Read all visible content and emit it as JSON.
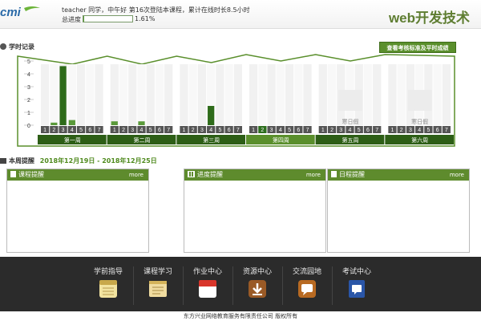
{
  "header": {
    "logo_text": "cmi",
    "greeting": "teacher 同学，中午好  第16次登陆本课程，累计在线时长8.5小时",
    "progress_label": "总进度",
    "progress_value": 0.0161,
    "progress_text": "1.61%",
    "brand": "web开发技术"
  },
  "study": {
    "title": "学时记录",
    "button": "查看考核标准及平时成绩"
  },
  "chart_data": {
    "type": "bar",
    "yticks": [
      "5",
      "4",
      "3",
      "2",
      "1",
      "0"
    ],
    "ylim": [
      0,
      5
    ],
    "day_labels": [
      "1",
      "2",
      "3",
      "4",
      "5",
      "6",
      "7"
    ],
    "weeks": [
      {
        "label": "第一周",
        "values": [
          0,
          0.2,
          4.6,
          0.4,
          0,
          0,
          0
        ],
        "rest": false
      },
      {
        "label": "第二周",
        "values": [
          0.3,
          0,
          0,
          0.3,
          0,
          0,
          0
        ],
        "rest": false
      },
      {
        "label": "第三周",
        "values": [
          0,
          0,
          0,
          1.5,
          0,
          0,
          0
        ],
        "rest": false
      },
      {
        "label": "第四周",
        "values": [
          0,
          0,
          0,
          0,
          0,
          0,
          0
        ],
        "rest": false,
        "highlight_day": 2
      },
      {
        "label": "第五周",
        "values": [
          0,
          0,
          0,
          0,
          0,
          0,
          0
        ],
        "rest": true,
        "rest_label": "寒日假"
      },
      {
        "label": "第六周",
        "values": [
          0,
          0,
          0,
          0,
          0,
          0,
          0
        ],
        "rest": true,
        "rest_label": "寒日假"
      }
    ],
    "colors": {
      "bar": "#2e6b1a",
      "bar_light": "#5a9a3a",
      "week_bar": "#2d5e16",
      "week_active": "#5a8f2c"
    }
  },
  "reminders": {
    "title": "本周提醒",
    "date_range": "2018年12月19日  - 2018年12月25日",
    "panels": [
      {
        "title": "课程提醒",
        "more": "more"
      },
      {
        "title": "进度提醒",
        "more": "more"
      },
      {
        "title": "日程提醒",
        "more": "more"
      }
    ]
  },
  "nav": [
    {
      "label": "学前指导",
      "icon": "notepad-icon"
    },
    {
      "label": "课程学习",
      "icon": "book-icon"
    },
    {
      "label": "作业中心",
      "icon": "calendar-icon"
    },
    {
      "label": "资源中心",
      "icon": "download-icon"
    },
    {
      "label": "交流园地",
      "icon": "chat-icon"
    },
    {
      "label": "考试中心",
      "icon": "exam-book-icon"
    }
  ],
  "footer": {
    "copyright": "东方兴业网络教育服务有限责任公司      版权所有"
  }
}
